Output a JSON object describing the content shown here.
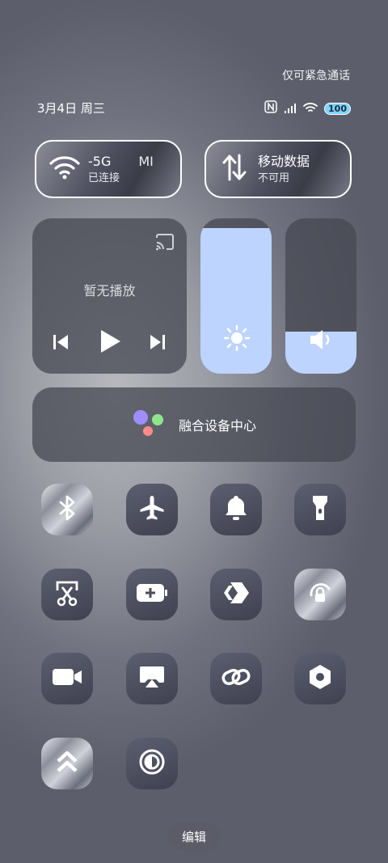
{
  "header": {
    "emergency": "仅可紧急通话",
    "date": "3月4日 周三",
    "battery": "100"
  },
  "wifi_pill": {
    "network": "-5G",
    "network_suffix": "MI",
    "status": "已连接"
  },
  "data_pill": {
    "label": "移动数据",
    "status": "不可用"
  },
  "media": {
    "title": "暂无播放"
  },
  "sliders": {
    "brightness_level": 0.94,
    "volume_level": 0.27
  },
  "fusion": {
    "label": "融合设备中心"
  },
  "tiles": [
    "bluetooth-icon",
    "airplane-icon",
    "bell-icon",
    "flashlight-icon",
    "screenshot-icon",
    "battery-saver-icon",
    "flow-icon",
    "rotation-lock-icon",
    "video-icon",
    "screen-cast-icon",
    "link-icon",
    "settings-hex-icon",
    "shortcut-icon",
    "dark-mode-icon"
  ],
  "edit": {
    "label": "编辑"
  },
  "colors": {
    "accent": "#bcd4ff",
    "tile": "#4c4e5e"
  }
}
